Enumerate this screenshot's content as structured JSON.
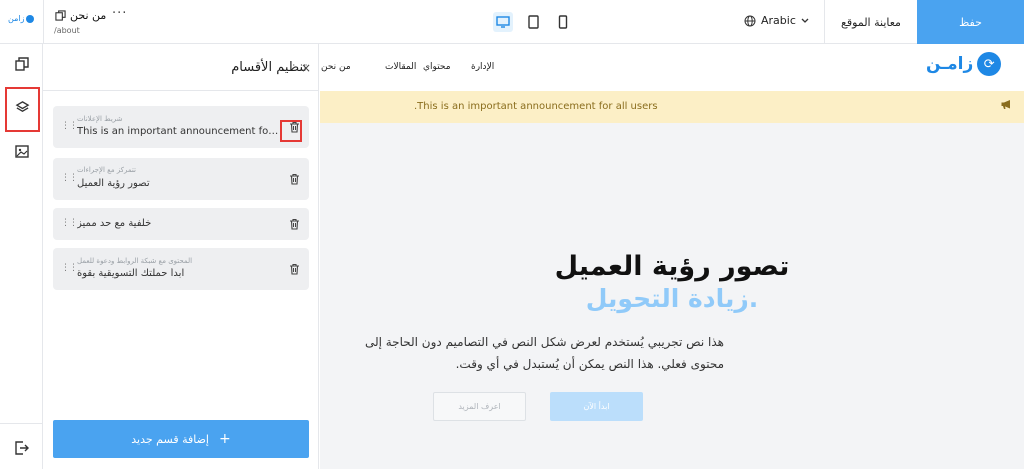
{
  "header": {
    "brand": "زامن",
    "page_title": "من نحن",
    "page_path": "/about",
    "more": "···",
    "language": "Arabic",
    "preview_label": "معاينة الموقع",
    "save_label": "حفظ"
  },
  "panel": {
    "title": "تنظيم الأقسام",
    "close": "×",
    "sections": [
      {
        "sub": "شريط الإعلانات",
        "main": "This is an important announcement for a..."
      },
      {
        "sub": "تتمركز مع الإجراءات",
        "main": "تصور رؤية العميل"
      },
      {
        "sub": "",
        "main": "خلفية مع حد مميز"
      },
      {
        "sub": "المحتوى مع شبكة الروابط ودعوة للعمل",
        "main": "ابدأ حملتك التسويقية بقوة"
      }
    ],
    "add_label": "إضافة قسم جديد",
    "add_plus": "+"
  },
  "site": {
    "logo_text": "زامـن",
    "nav": [
      "من نحن",
      "المقالات",
      "محتواي",
      "الإدارة"
    ],
    "announcement": ".This is an important announcement for all users",
    "hero_title": "تصور رؤية العميل",
    "hero_subtitle": "زيادة التحويل.",
    "hero_text": "هذا نص تجريبي يُستخدم لعرض شكل النص في التصاميم دون الحاجة إلى محتوى فعلي. هذا النص يمكن أن يُستبدل في أي وقت.",
    "cta_primary": "ابدأ الآن",
    "cta_secondary": "اعرف المزيد"
  },
  "colors": {
    "accent": "#4aa3f0",
    "brand": "#1e88e5",
    "highlight": "#e53935",
    "announcement_bg": "#fcefc6"
  }
}
